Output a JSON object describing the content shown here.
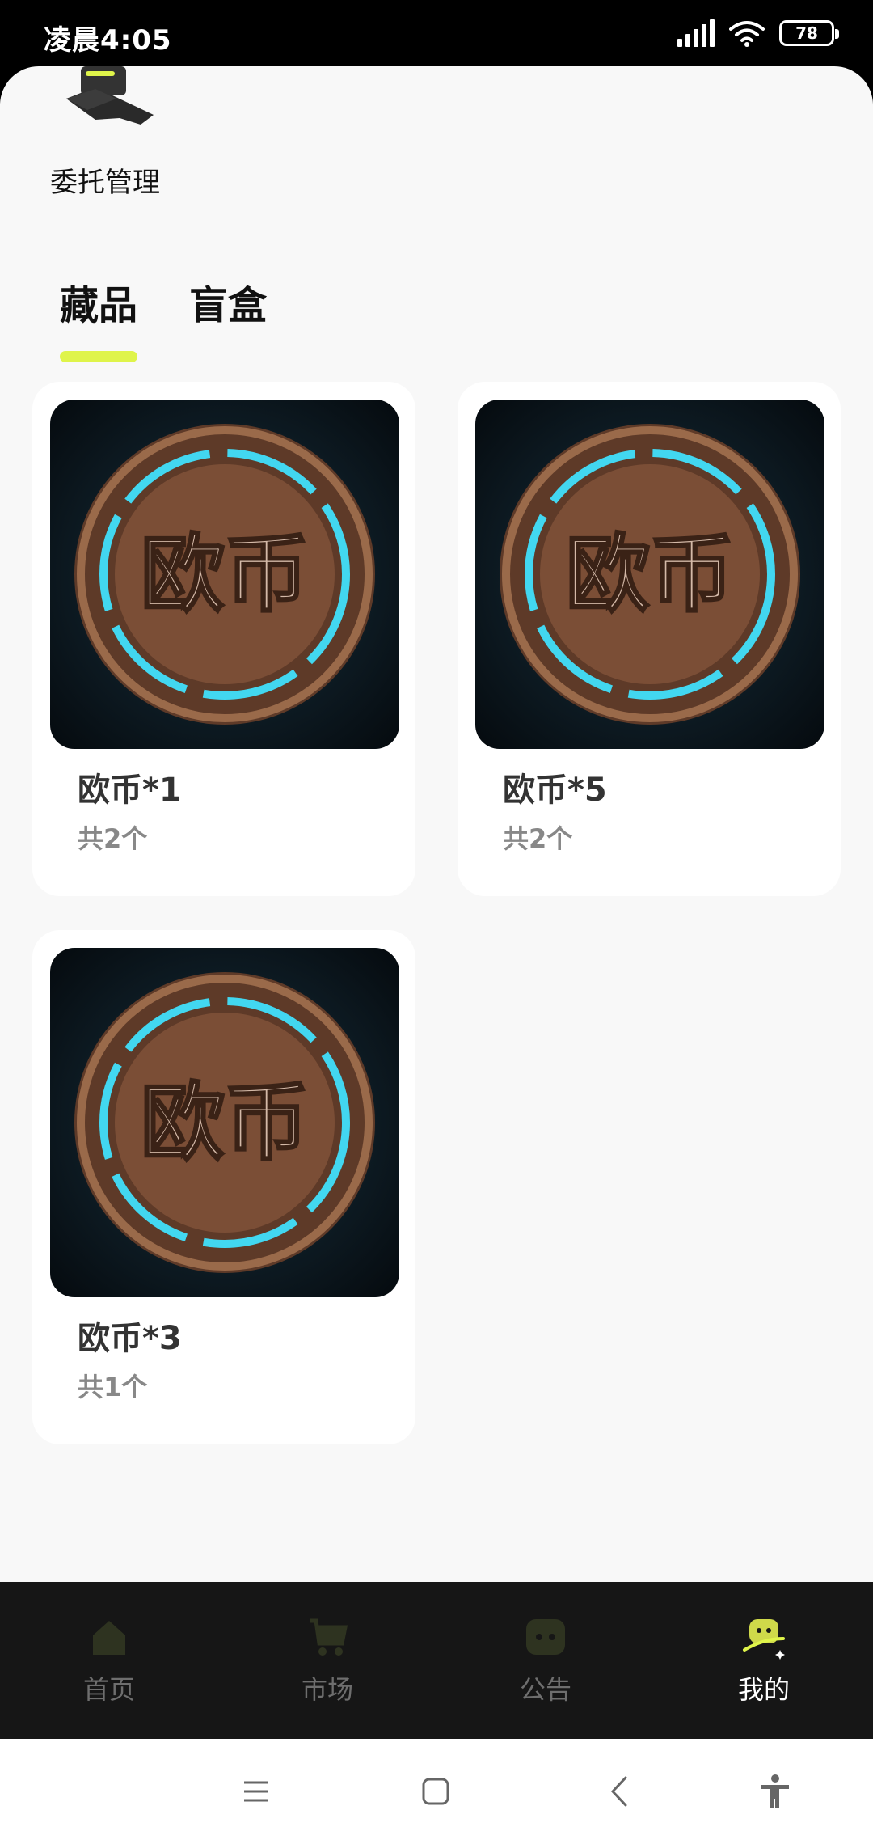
{
  "status_bar": {
    "time": "凌晨4:05",
    "battery": "78"
  },
  "entrust": {
    "label": "委托管理"
  },
  "tabs": [
    {
      "label": "藏品",
      "active": true
    },
    {
      "label": "盲盒",
      "active": false
    }
  ],
  "cards": [
    {
      "title": "欧币*1",
      "count": "共2个",
      "coin_text": "欧币"
    },
    {
      "title": "欧币*5",
      "count": "共2个",
      "coin_text": "欧币"
    },
    {
      "title": "欧币*3",
      "count": "共1个",
      "coin_text": "欧币"
    }
  ],
  "bottom_nav": [
    {
      "label": "首页",
      "icon": "home-icon"
    },
    {
      "label": "市场",
      "icon": "cart-icon"
    },
    {
      "label": "公告",
      "icon": "chat-icon"
    },
    {
      "label": "我的",
      "icon": "mascot-icon",
      "active": true
    }
  ],
  "colors": {
    "accent": "#dff44a",
    "nav_bg": "#161616",
    "nav_icon_inactive": "#2e3320",
    "coin_glow": "#42d7f0",
    "coin_bronze": "#8a5a3c"
  }
}
